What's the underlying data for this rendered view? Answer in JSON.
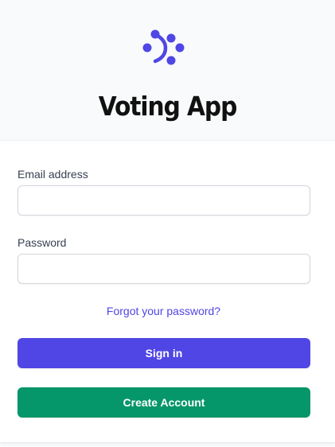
{
  "app": {
    "title": "Voting App",
    "logo_icon": "brand-logo-icon",
    "brand_color": "#4f46e5"
  },
  "form": {
    "email": {
      "label": "Email address",
      "value": "",
      "placeholder": ""
    },
    "password": {
      "label": "Password",
      "value": "",
      "placeholder": ""
    },
    "forgot_password_label": "Forgot your password?",
    "sign_in_label": "Sign in",
    "create_account_label": "Create Account"
  },
  "colors": {
    "primary_button": "#4f46e5",
    "success_button": "#059669",
    "link": "#4f46e5"
  }
}
